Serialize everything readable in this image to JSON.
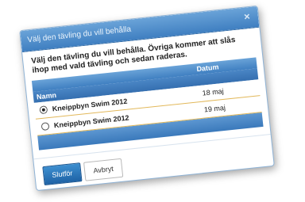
{
  "dialog": {
    "title": "Välj den tävling du vill behålla",
    "close_label": "×",
    "message": "Välj den tävling du vill behålla. Övriga kommer att slås ihop med vald tävling och sedan raderas."
  },
  "table": {
    "header_date": "Datum",
    "header_name": "Namn",
    "rows": [
      {
        "name": "Kneippbyn Swim 2012",
        "date": "18 maj",
        "selected": true
      },
      {
        "name": "Kneippbyn Swim 2012",
        "date": "19 maj",
        "selected": false
      }
    ]
  },
  "buttons": {
    "finish_label": "Slutför",
    "cancel_label": "Avbryt"
  },
  "colors": {
    "accent": "#3f7fc1",
    "row_border": "#e2b85a",
    "primary_button": "#1f63a6"
  },
  "icons": {
    "close": "close-icon"
  }
}
